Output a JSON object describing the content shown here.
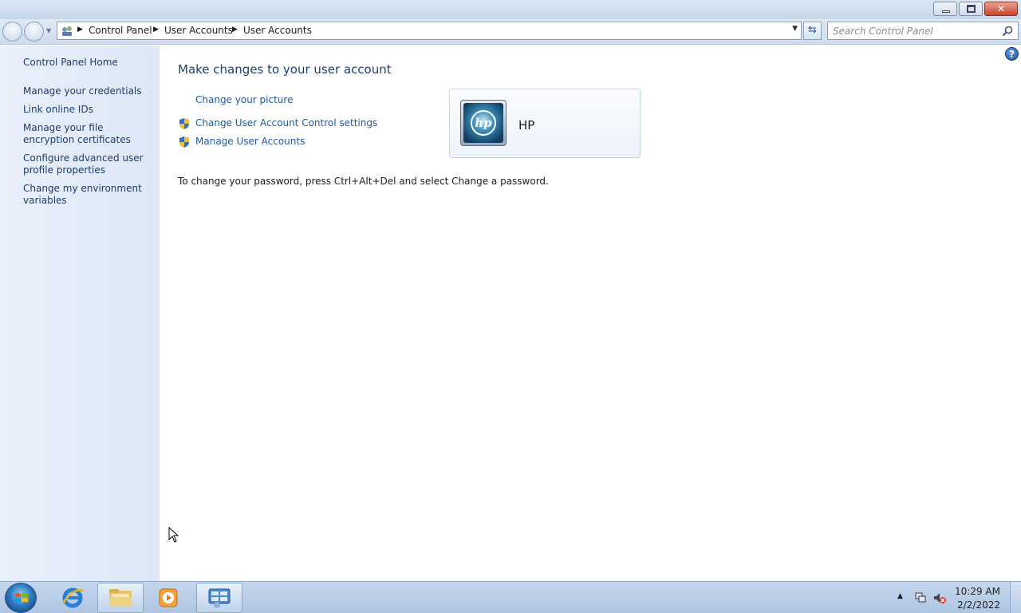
{
  "window": {
    "buttons": {
      "minimize": "minimize",
      "restore": "restore",
      "close": "close"
    }
  },
  "address_bar": {
    "breadcrumbs": [
      "Control Panel",
      "User Accounts",
      "User Accounts"
    ]
  },
  "search": {
    "placeholder": "Search Control Panel"
  },
  "left_pane": {
    "items": [
      {
        "label": "Control Panel Home"
      },
      {
        "label": "Manage your credentials"
      },
      {
        "label": "Link online IDs"
      },
      {
        "label": "Manage your file encryption certificates"
      },
      {
        "label": "Configure advanced user profile properties"
      },
      {
        "label": "Change my environment variables"
      }
    ]
  },
  "main": {
    "title": "Make changes to your user account",
    "tasks": [
      {
        "label": "Change your picture",
        "shield": false
      },
      {
        "label": "Change User Account Control settings",
        "shield": true
      },
      {
        "label": "Manage User Accounts",
        "shield": true
      }
    ],
    "account": {
      "name": "HP",
      "logo_text": "hp"
    },
    "password_note": "To change your password, press Ctrl+Alt+Del and select Change a password."
  },
  "taskbar": {
    "apps": [
      "start-orb",
      "internet-explorer",
      "windows-explorer",
      "media-player",
      "control-panel"
    ],
    "active_app": "control-panel",
    "clock": {
      "time": "10:29 AM",
      "date": "2/2/2022"
    }
  },
  "colors": {
    "link": "#1e5aa8",
    "title": "#1e3e78",
    "left_pane_bg": "#e4ecf8"
  }
}
